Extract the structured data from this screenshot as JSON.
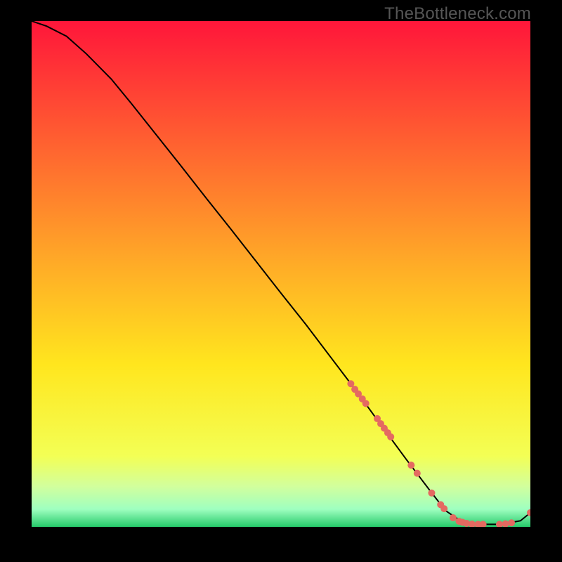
{
  "watermark": "TheBottleneck.com",
  "colors": {
    "black": "#000000",
    "line": "#000000",
    "point": "#e46a61",
    "grad_top": "#ff163a",
    "grad_mid": "#ffdc1e",
    "grad_low1": "#e6ff6f",
    "grad_low2": "#b6ffb6",
    "grad_bottom": "#2dd36f"
  },
  "chart_data": {
    "type": "line",
    "title": "",
    "xlabel": "",
    "ylabel": "",
    "xlim": [
      0,
      100
    ],
    "ylim": [
      0,
      100
    ],
    "curve": [
      {
        "x": 0,
        "y": 100
      },
      {
        "x": 3,
        "y": 99
      },
      {
        "x": 7,
        "y": 97
      },
      {
        "x": 11,
        "y": 93.5
      },
      {
        "x": 16,
        "y": 88.5
      },
      {
        "x": 20,
        "y": 83.7
      },
      {
        "x": 25,
        "y": 77.5
      },
      {
        "x": 30,
        "y": 71.3
      },
      {
        "x": 35,
        "y": 65
      },
      {
        "x": 40,
        "y": 58.8
      },
      {
        "x": 45,
        "y": 52.5
      },
      {
        "x": 50,
        "y": 46.2
      },
      {
        "x": 55,
        "y": 40
      },
      {
        "x": 60,
        "y": 33.5
      },
      {
        "x": 65,
        "y": 27
      },
      {
        "x": 70,
        "y": 20.2
      },
      {
        "x": 75,
        "y": 13.5
      },
      {
        "x": 80,
        "y": 7
      },
      {
        "x": 83,
        "y": 3.2
      },
      {
        "x": 86,
        "y": 1.2
      },
      {
        "x": 90,
        "y": 0.5
      },
      {
        "x": 94,
        "y": 0.5
      },
      {
        "x": 98,
        "y": 1.2
      },
      {
        "x": 100,
        "y": 2.8
      }
    ],
    "points": [
      {
        "x": 64.0,
        "y": 28.3,
        "r": 5
      },
      {
        "x": 64.8,
        "y": 27.2,
        "r": 5
      },
      {
        "x": 65.5,
        "y": 26.3,
        "r": 5
      },
      {
        "x": 66.3,
        "y": 25.3,
        "r": 5
      },
      {
        "x": 67.0,
        "y": 24.4,
        "r": 5
      },
      {
        "x": 69.3,
        "y": 21.4,
        "r": 5
      },
      {
        "x": 70.0,
        "y": 20.4,
        "r": 5
      },
      {
        "x": 70.7,
        "y": 19.5,
        "r": 5
      },
      {
        "x": 71.4,
        "y": 18.6,
        "r": 5
      },
      {
        "x": 72.0,
        "y": 17.8,
        "r": 5
      },
      {
        "x": 76.1,
        "y": 12.2,
        "r": 5
      },
      {
        "x": 77.3,
        "y": 10.6,
        "r": 5
      },
      {
        "x": 80.2,
        "y": 6.7,
        "r": 5
      },
      {
        "x": 82.0,
        "y": 4.4,
        "r": 5
      },
      {
        "x": 82.7,
        "y": 3.6,
        "r": 5
      },
      {
        "x": 84.5,
        "y": 1.8,
        "r": 5
      },
      {
        "x": 85.7,
        "y": 1.1,
        "r": 5
      },
      {
        "x": 86.4,
        "y": 0.9,
        "r": 5
      },
      {
        "x": 87.2,
        "y": 0.7,
        "r": 5
      },
      {
        "x": 88.3,
        "y": 0.55,
        "r": 5
      },
      {
        "x": 89.5,
        "y": 0.5,
        "r": 5
      },
      {
        "x": 90.5,
        "y": 0.5,
        "r": 5
      },
      {
        "x": 93.8,
        "y": 0.5,
        "r": 5
      },
      {
        "x": 95.0,
        "y": 0.6,
        "r": 5
      },
      {
        "x": 96.2,
        "y": 0.8,
        "r": 5
      },
      {
        "x": 100.0,
        "y": 2.8,
        "r": 5
      }
    ]
  }
}
